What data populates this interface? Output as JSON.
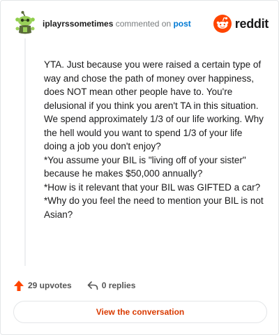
{
  "comment": {
    "username": "iplayrssometimes",
    "action_text": "commented on",
    "target_link": "post",
    "paragraphs": [
      "YTA. Just because you were raised a certain type of way and chose the path of money over happiness, does NOT mean other people have to. You're delusional if you think you aren't TA in this situation.",
      "We spend approximately 1/3 of our life working. Why the hell would you want to spend 1/3 of your life doing a job you don't enjoy?",
      "*You assume your BIL is \"living off of your sister\" because he makes $50,000 annually?",
      "*How is it relevant that your BIL was GIFTED a car?",
      "*Why do you feel the need to mention your BIL is not Asian?"
    ]
  },
  "brand": {
    "wordmark": "reddit",
    "color": "#ff4500"
  },
  "stats": {
    "upvotes": "29 upvotes",
    "replies": "0 replies"
  },
  "cta": {
    "label": "View the conversation",
    "color": "#d93a00"
  },
  "icons": {
    "avatar": "snoo-avatar-icon",
    "logo": "reddit-alien-icon",
    "upvote": "upvote-arrow-icon",
    "reply": "reply-arrow-icon"
  }
}
